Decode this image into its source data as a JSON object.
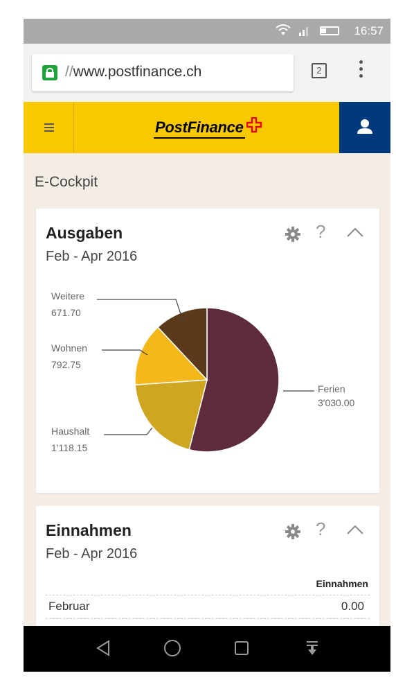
{
  "status_bar": {
    "time": "16:57"
  },
  "browser": {
    "url_scheme": "//",
    "url_host": "www.postfinance.ch",
    "tab_count": "2"
  },
  "app_header": {
    "logo_text": "PostFinance",
    "brand_color": "#f8c800",
    "user_button_color": "#003a7d"
  },
  "page": {
    "title": "E-Cockpit"
  },
  "expenses": {
    "title": "Ausgaben",
    "period": "Feb  -  Apr 2016",
    "help": "?",
    "chart_data": {
      "type": "pie",
      "slices": [
        {
          "name": "Ferien",
          "value": 3030.0,
          "label": "3'030.00",
          "color": "#5e2a3e"
        },
        {
          "name": "Haushalt",
          "value": 1118.15,
          "label": "1'118.15",
          "color": "#cea621"
        },
        {
          "name": "Wohnen",
          "value": 792.75,
          "label": "792.75",
          "color": "#f5b81b"
        },
        {
          "name": "Weitere",
          "value": 671.7,
          "label": "671.70",
          "color": "#5b3a1b"
        }
      ]
    }
  },
  "income": {
    "title": "Einnahmen",
    "period": "Feb  -  Apr 2016",
    "help": "?",
    "column_header": "Einnahmen",
    "rows": [
      {
        "month": "Februar",
        "value": "0.00"
      }
    ]
  }
}
